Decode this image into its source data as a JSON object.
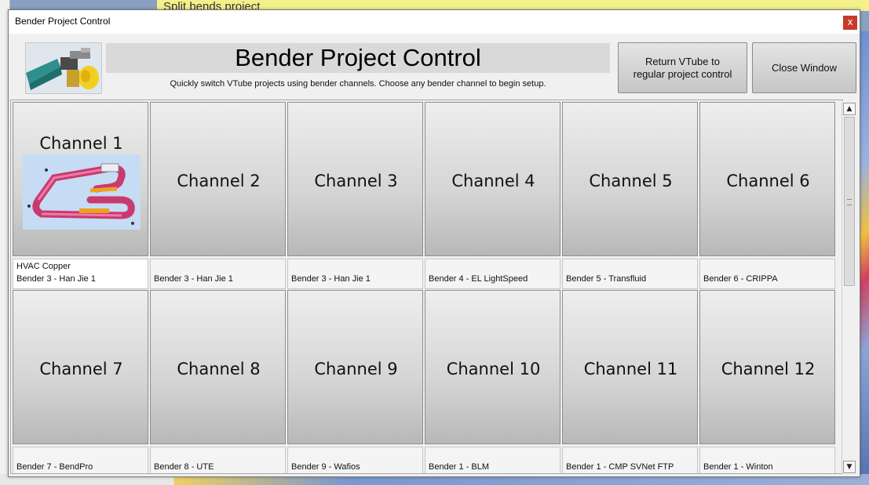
{
  "background": {
    "window_title_text": "Split bends project"
  },
  "window": {
    "title": "Bender Project Control",
    "close_glyph": "x"
  },
  "header": {
    "heading": "Bender Project Control",
    "subtitle": "Quickly switch VTube projects using bender channels. Choose any bender channel to begin setup.",
    "logo_icon": "bender-machine-icon"
  },
  "buttons": {
    "return_line1": "Return VTube to",
    "return_line2": "regular project control",
    "close": "Close Window"
  },
  "channels": [
    {
      "label": "Channel 1",
      "project": "HVAC Copper",
      "bender": "Bender 3 - Han Jie 1",
      "has_thumbnail": true,
      "selected": true
    },
    {
      "label": "Channel 2",
      "project": "",
      "bender": "Bender 3 - Han Jie 1"
    },
    {
      "label": "Channel 3",
      "project": "",
      "bender": "Bender 3 - Han Jie 1"
    },
    {
      "label": "Channel 4",
      "project": "",
      "bender": "Bender 4 - EL LightSpeed"
    },
    {
      "label": "Channel 5",
      "project": "",
      "bender": "Bender 5 - Transfluid"
    },
    {
      "label": "Channel 6",
      "project": "",
      "bender": "Bender 6 - CRIPPA"
    },
    {
      "label": "Channel 7",
      "project": "",
      "bender": "Bender 7 - BendPro"
    },
    {
      "label": "Channel 8",
      "project": "",
      "bender": "Bender 8 - UTE"
    },
    {
      "label": "Channel 9",
      "project": "",
      "bender": "Bender 9 - Wafios"
    },
    {
      "label": "Channel 10",
      "project": "",
      "bender": "Bender 1 - BLM"
    },
    {
      "label": "Channel 11",
      "project": "",
      "bender": "Bender 1 - CMP SVNet FTP"
    },
    {
      "label": "Channel 12",
      "project": "",
      "bender": "Bender 1 - Winton"
    }
  ],
  "scrollbar": {
    "up_icon": "chevron-up-icon",
    "down_icon": "chevron-down-icon"
  },
  "colors": {
    "close_red": "#c8392b",
    "thumb_tube": "#e0407a"
  }
}
